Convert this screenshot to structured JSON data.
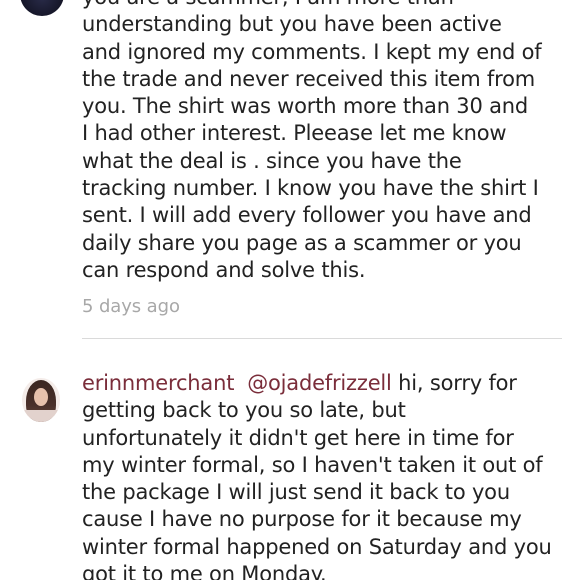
{
  "comments": [
    {
      "username": "",
      "text": "you are a scammer, I am more than\nunderstanding but you have been active\nand ignored my comments. I kept my end of\nthe trade and never received this item from\nyou.  The shirt was worth more than 30 and\nI had other interest. Pleease let me know\nwhat the deal is . since you have the\ntracking number. I know you have the shirt I\nsent. I will add every follower you have and\ndaily share you page as a scammer or you\ncan respond and solve this.",
      "timestamp": "5 days ago"
    },
    {
      "username": "erinnmerchant",
      "mention": "@ojadefrizzell",
      "text": "hi, sorry for getting back to you so late, but unfortunately it didn't get here in time for my winter formal, so I haven't taken it out of the package I will just send it back to you cause I have no purpose for it because my winter formal happened on Saturday and you got it to me on Monday."
    }
  ],
  "colors": {
    "username": "#7a2d3a",
    "timestamp": "#a8a8a8",
    "text": "#222222",
    "divider": "#dadada"
  }
}
